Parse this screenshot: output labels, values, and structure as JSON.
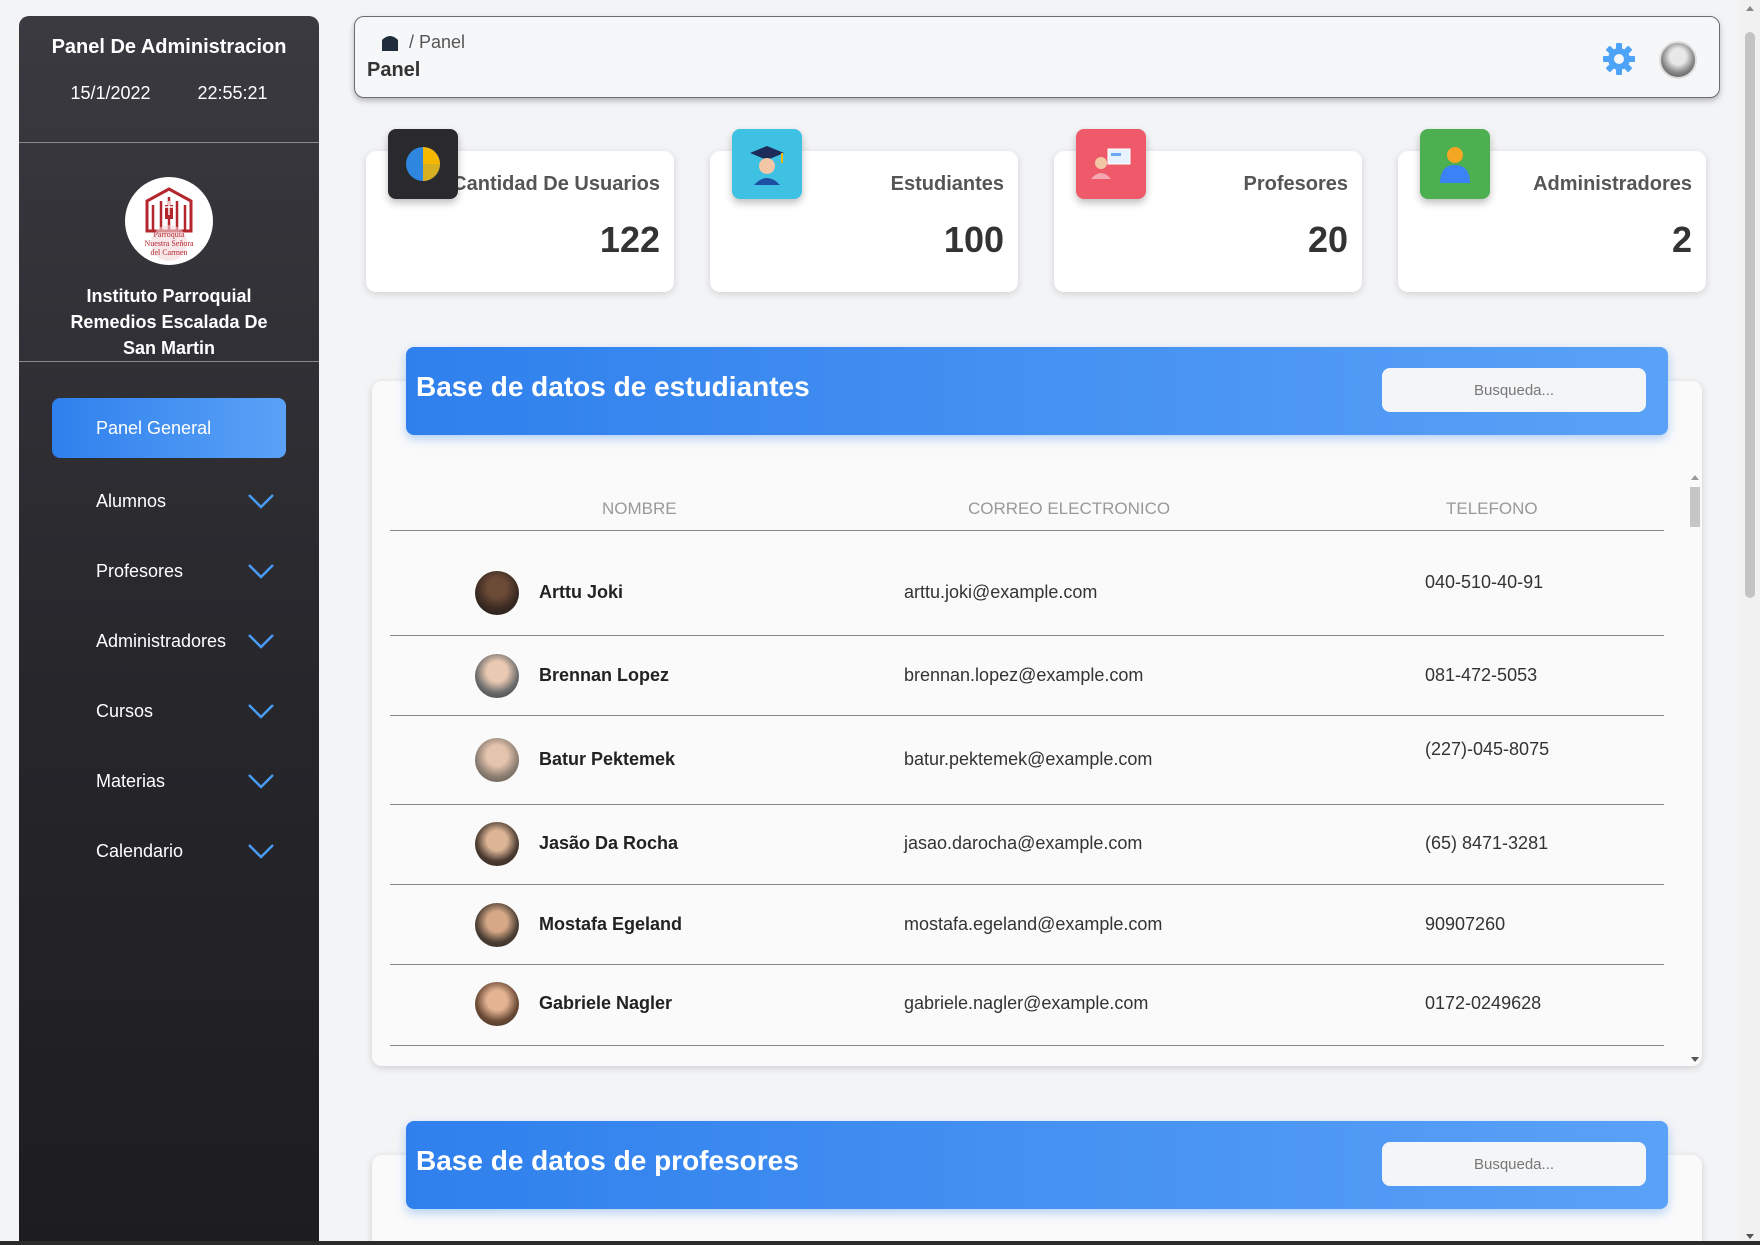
{
  "sidebar": {
    "title": "Panel De Administracion",
    "date": "15/1/2022",
    "time": "22:55:21",
    "logo_text": [
      "Parroquia",
      "Nuestra Señora",
      "del Carmen"
    ],
    "school_name": "Instituto Parroquial Remedios Escalada De San Martin",
    "active_item": "Panel General",
    "items": [
      {
        "label": "Alumnos"
      },
      {
        "label": "Profesores"
      },
      {
        "label": "Administradores"
      },
      {
        "label": "Cursos"
      },
      {
        "label": "Materias"
      },
      {
        "label": "Calendario"
      }
    ]
  },
  "header": {
    "breadcrumb": "/ Panel",
    "title": "Panel",
    "icons": [
      "home-icon",
      "settings-gear-icon",
      "user-avatar"
    ]
  },
  "stats": [
    {
      "label": "Cantidad De Usuarios",
      "value": "122",
      "icon": "pie-chart-icon",
      "color": "#2a2a2e"
    },
    {
      "label": "Estudiantes",
      "value": "100",
      "icon": "graduate-icon",
      "color": "#3ec1e3"
    },
    {
      "label": "Profesores",
      "value": "20",
      "icon": "teacher-icon",
      "color": "#ee5a6a"
    },
    {
      "label": "Administradores",
      "value": "2",
      "icon": "admin-user-icon",
      "color": "#4caf50"
    }
  ],
  "students_db": {
    "title": "Base de datos de estudiantes",
    "search_placeholder": "Busqueda...",
    "columns": [
      "NOMBRE",
      "CORREO ELECTRONICO",
      "TELEFONO"
    ],
    "rows": [
      {
        "name": "Arttu Joki",
        "email": "arttu.joki@example.com",
        "phone": "040-510-40-91"
      },
      {
        "name": "Brennan Lopez",
        "email": "brennan.lopez@example.com",
        "phone": "081-472-5053"
      },
      {
        "name": "Batur Pektemek",
        "email": "batur.pektemek@example.com",
        "phone": "(227)-045-8075"
      },
      {
        "name": "Jasão Da Rocha",
        "email": "jasao.darocha@example.com",
        "phone": "(65) 8471-3281"
      },
      {
        "name": "Mostafa Egeland",
        "email": "mostafa.egeland@example.com",
        "phone": "90907260"
      },
      {
        "name": "Gabriele Nagler",
        "email": "gabriele.nagler@example.com",
        "phone": "0172-0249628"
      }
    ]
  },
  "teachers_db": {
    "title": "Base de datos de profesores",
    "search_placeholder": "Busqueda..."
  },
  "colors": {
    "accent": "#2f80ed",
    "accent_light": "#5aa2f7",
    "sidebar_dark": "#26262b"
  }
}
